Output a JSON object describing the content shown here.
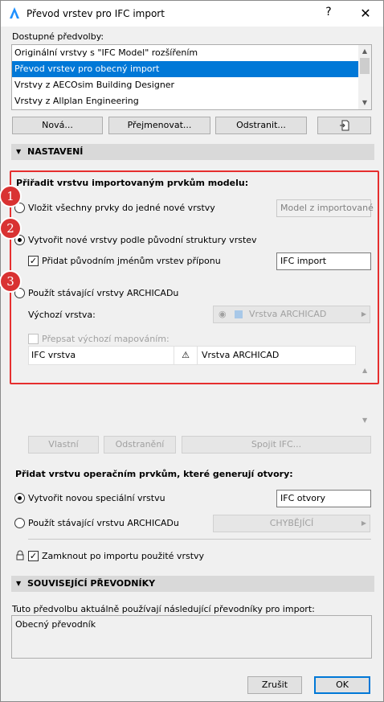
{
  "window": {
    "title": "Převod vrstev pro IFC import",
    "help": "?",
    "close": "✕"
  },
  "presets": {
    "label": "Dostupné předvolby:",
    "items": [
      "Originální vrstvy s \"IFC Model\" rozšířením",
      "Převod vrstev pro obecný import",
      "Vrstvy z AECOsim Building Designer",
      "Vrstvy z Allplan Engineering"
    ],
    "selected_index": 1,
    "buttons": {
      "new": "Nová...",
      "rename": "Přejmenovat...",
      "delete": "Odstranit..."
    }
  },
  "settings": {
    "header": "NASTAVENÍ",
    "assign_title": "Přiřadit vrstvu importovaným prvkům modelu:",
    "badges": [
      "1",
      "2",
      "3"
    ],
    "opt1_label": "Vložit všechny prvky do jedné nové vrstvy",
    "opt1_value": "Model z importované",
    "opt2_label": "Vytvořit nové vrstvy podle původní struktury vrstev",
    "opt2_suffix_label": "Přidat původním jménům vrstev příponu",
    "opt2_suffix_value": "IFC import",
    "opt3_label": "Použít stávající vrstvy ARCHICADu",
    "default_layer_label": "Výchozí vrstva:",
    "default_layer_value": "Vrstva ARCHICAD",
    "override_label": "Přepsat výchozí mapováním:",
    "table": {
      "col1": "IFC vrstva",
      "col2": "Vrstva ARCHICAD"
    },
    "table_buttons": {
      "custom": "Vlastní",
      "remove": "Odstranění",
      "merge": "Spojit IFC..."
    },
    "selected_option": 2,
    "suffix_checked": true
  },
  "openings": {
    "title": "Přidat vrstvu operačním prvkům, které generují otvory:",
    "opt1_label": "Vytvořit novou speciální vrstvu",
    "opt1_value": "IFC otvory",
    "opt2_label": "Použít stávající vrstvu ARCHICADu",
    "opt2_value": "CHYBĚJÍCÍ"
  },
  "lock": {
    "label": "Zamknout po importu použité vrstvy",
    "checked": true
  },
  "related": {
    "header": "SOUVISEJÍCÍ PŘEVODNÍKY",
    "description": "Tuto předvolbu aktuálně používají následující převodníky pro import:",
    "item": "Obecný převodník"
  },
  "footer": {
    "cancel": "Zrušit",
    "ok": "OK"
  },
  "colors": {
    "accent": "#0078d7",
    "highlight_box": "#e62e2e",
    "badge": "#d93232"
  }
}
